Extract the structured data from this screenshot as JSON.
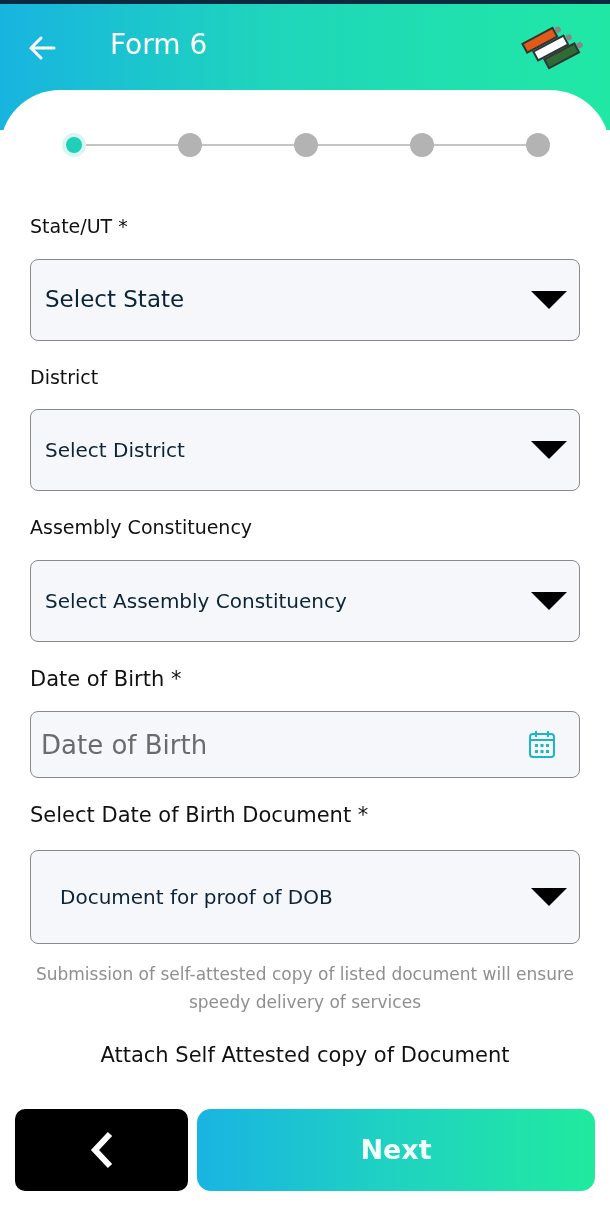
{
  "header": {
    "title": "Form 6"
  },
  "steps": [
    {
      "selected": true
    },
    {
      "selected": false
    },
    {
      "selected": false
    },
    {
      "selected": false
    },
    {
      "selected": false
    }
  ],
  "fields": [
    {
      "kind": "select",
      "label": "State/UT *",
      "value": "Select State"
    },
    {
      "kind": "select",
      "label": "District",
      "value": "Select District"
    },
    {
      "kind": "select",
      "label": "Assembly Constituency",
      "value": "Select Assembly Constituency"
    },
    {
      "kind": "date",
      "label": "Date of Birth *",
      "placeholder": "Date of Birth"
    },
    {
      "kind": "select",
      "label": "Select Date of Birth Document *",
      "value": "Document for proof of DOB"
    }
  ],
  "hint": "Submission of self-attested copy of listed document will ensure speedy delivery of services",
  "attach_label": "Attach Self Attested copy of Document",
  "buttons": {
    "next": "Next"
  }
}
